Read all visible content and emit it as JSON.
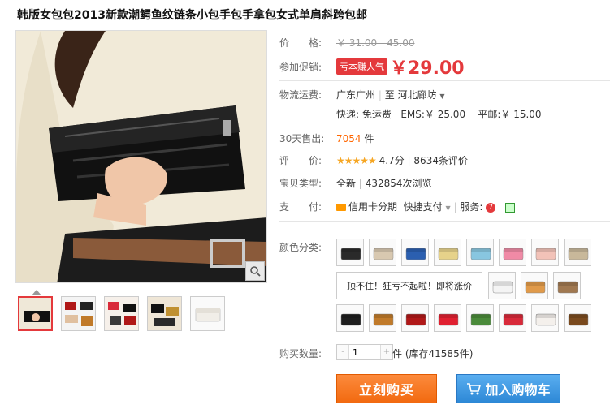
{
  "product": {
    "title": "韩版女包包2013新款潮鳄鱼纹链条小包手包手拿包女式单肩斜跨包邮"
  },
  "price": {
    "label": "价　　格:",
    "original": "￥ 31.00 - 45.00",
    "promo_label": "参加促销:",
    "promo_tag": "亏本赚人气",
    "current": "￥29.00"
  },
  "shipping": {
    "label": "物流运费:",
    "from": "广东广州",
    "to_prefix": "至",
    "to": "河北廊坊",
    "express": "快递: 免运费",
    "ems": "EMS:￥ 25.00",
    "post": "平邮:￥ 15.00"
  },
  "sales": {
    "label": "30天售出:",
    "count": "7054",
    "unit": "件"
  },
  "rating": {
    "label": "评　　价:",
    "stars": "★★★★★",
    "score": "4.7分",
    "separator": "|",
    "reviews": "8634条评价"
  },
  "type": {
    "label": "宝贝类型:",
    "condition": "全新",
    "separator": "|",
    "views": "432854次浏览"
  },
  "payment": {
    "label": "支　　付:",
    "credit": "信用卡分期",
    "quick": "快捷支付",
    "service_label": "服务:",
    "tmall_icon_text": "7"
  },
  "colors": {
    "label": "颜色分类:",
    "text_option": "顶不住！狂亏不起啦！即将涨价",
    "swatch_colors_row1": [
      "#2a2a2a",
      "#d8c8b0",
      "#2b5fb0",
      "#e6d28a",
      "#88c6e0",
      "#f08aa6",
      "#f2c2b8",
      "#c8b89a"
    ],
    "swatch_colors_row2": [
      "#f4f4f4",
      "#e09a4a",
      "#a07850"
    ],
    "swatch_colors_row3": [
      "#1e1e1e",
      "#c07a2a",
      "#b01818",
      "#e02030",
      "#4a8a3a",
      "#d82a3a",
      "#f4f0ec",
      "#7a4a1e"
    ]
  },
  "quantity": {
    "label": "购买数量:",
    "value": "1",
    "unit": "件",
    "stock": "(库存41585件)",
    "minus": "-",
    "plus": "+"
  },
  "actions": {
    "buy_now": "立刻购买",
    "add_to_cart": "加入购物车"
  }
}
